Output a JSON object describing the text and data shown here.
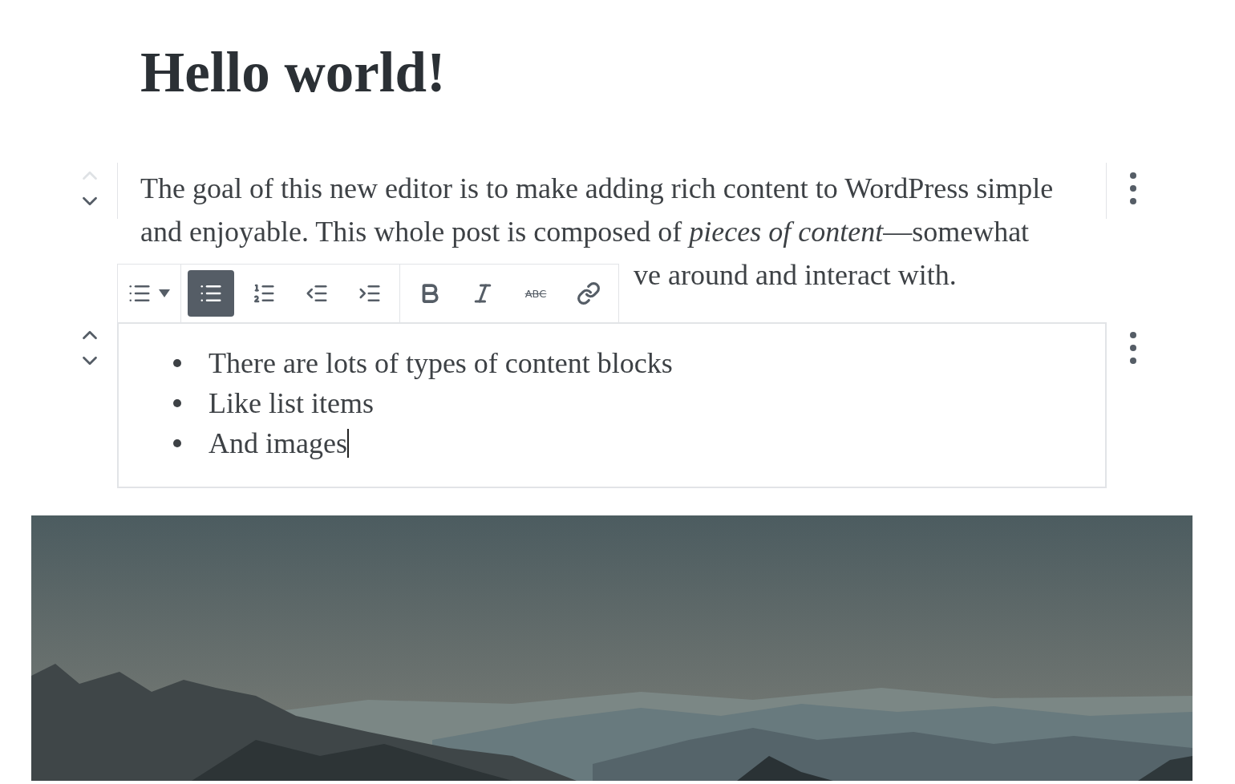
{
  "title": "Hello world!",
  "paragraph": {
    "mover": {
      "up_disabled": true,
      "down_disabled": false
    },
    "lines": [
      "The goal of this new editor is to make adding rich content to WordPress simple",
      "and enjoyable. This whole post is composed of *pieces of content*—somewhat",
      "ve around and interact with."
    ]
  },
  "toolbar": {
    "groups": [
      [
        {
          "kind": "list-switcher",
          "selected": false
        }
      ],
      [
        {
          "kind": "bullet-list",
          "selected": true
        },
        {
          "kind": "numbered-list",
          "selected": false
        },
        {
          "kind": "outdent",
          "selected": false
        },
        {
          "kind": "indent",
          "selected": false
        }
      ],
      [
        {
          "kind": "bold",
          "selected": false
        },
        {
          "kind": "italic",
          "selected": false
        },
        {
          "kind": "strikethrough",
          "label": "ABC",
          "selected": false
        },
        {
          "kind": "link",
          "selected": false
        }
      ]
    ]
  },
  "list": {
    "mover": {
      "up_disabled": false,
      "down_disabled": false
    },
    "items": [
      "There are lots of types of content blocks",
      "Like list items",
      "And images"
    ]
  }
}
